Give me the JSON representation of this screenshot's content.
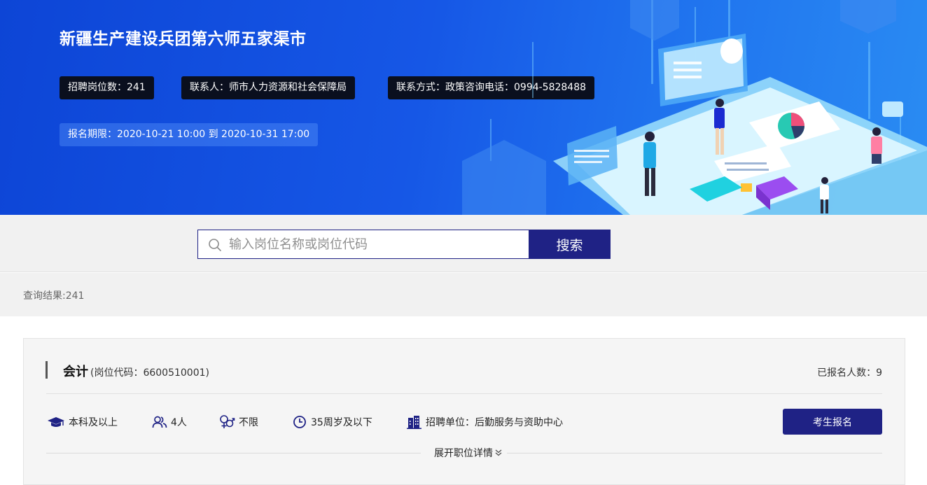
{
  "banner": {
    "title": "新疆生产建设兵团第六师五家渠市",
    "positions": "招聘岗位数：241",
    "contact": "联系人：师市人力资源和社会保障局",
    "phone": "联系方式：政策咨询电话：0994-5828488",
    "deadline": "报名期限：2020-10-21 10:00 到 2020-10-31 17:00"
  },
  "search": {
    "placeholder": "输入岗位名称或岗位代码",
    "button": "搜索"
  },
  "result": {
    "text": "查询结果:241"
  },
  "job": {
    "title": "会计",
    "code": "(岗位代码：6600510001)",
    "applicants": "已报名人数：9",
    "education": "本科及以上",
    "count": "4人",
    "gender": "不限",
    "age": "35周岁及以下",
    "unit": "招聘单位：后勤服务与资助中心",
    "apply": "考生报名",
    "expand": "展开职位详情"
  },
  "colors": {
    "accent": "#1f2285",
    "banner": "#1657e6"
  }
}
